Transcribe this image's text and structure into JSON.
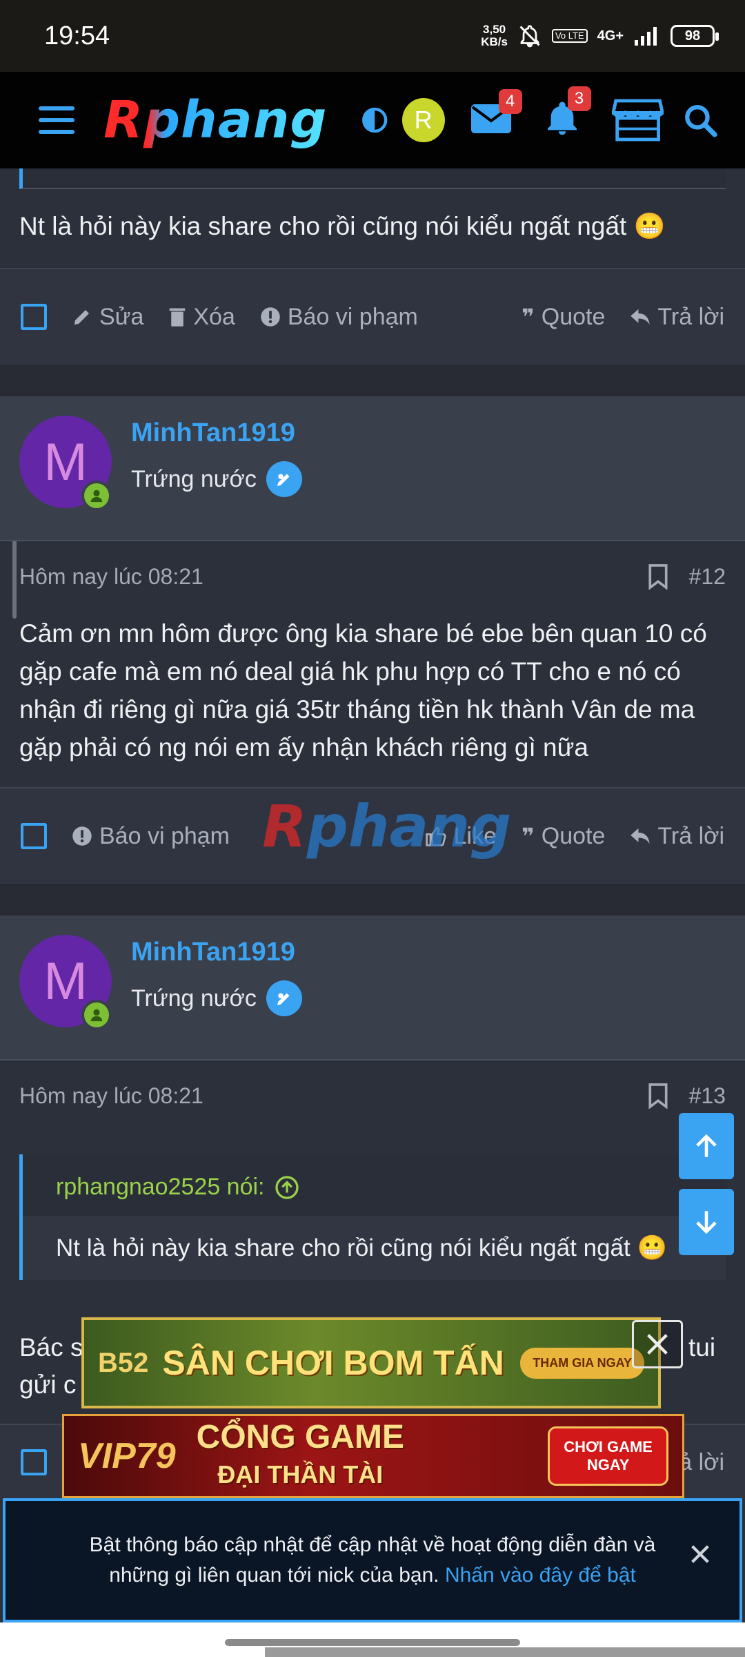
{
  "status_bar": {
    "time": "19:54",
    "net_speed_value": "3,50",
    "net_speed_unit": "KB/s",
    "volte": "Vo LTE",
    "network": "4G+",
    "battery": "98"
  },
  "app_bar": {
    "logo": "Rphang",
    "avatar_letter": "R",
    "messages_count": "4",
    "alerts_count": "3",
    "accent_color": "#3aa3f2"
  },
  "posts": [
    {
      "content": "Nt là hỏi này kia share cho rồi cũng nói kiểu ngất ngất 😬",
      "actions": {
        "edit": "Sửa",
        "delete": "Xóa",
        "report": "Báo vi phạm",
        "quote": "Quote",
        "reply": "Trả lời"
      }
    },
    {
      "user": {
        "initial": "M",
        "name": "MinhTan1919",
        "title": "Trứng nước"
      },
      "time": "Hôm nay lúc 08:21",
      "number": "#12",
      "content": "Cảm ơn mn hôm được ông kia share bé ebe bên quan 10 có gặp cafe mà em nó deal giá hk phu hợp có TT cho e nó có nhận đi riêng gì nữa giá 35tr tháng tiền hk thành Vân de ma gặp phải có ng nói em ấy nhận khách riêng gì nữa",
      "actions": {
        "report": "Báo vi phạm",
        "like": "Like",
        "quote": "Quote",
        "reply": "Trả lời"
      }
    },
    {
      "user": {
        "initial": "M",
        "name": "MinhTan1919",
        "title": "Trứng nước"
      },
      "time": "Hôm nay lúc 08:21",
      "number": "#13",
      "quote": {
        "author": "rphangnao2525 nói:",
        "text": "Nt là hỏi này kia share cho rồi cũng nói kiểu ngất ngất 😬"
      },
      "content_line1_start": "Bác s",
      "content_line1_end": "tui",
      "content_line2_start": "gửi c",
      "actions_reply_partial": "ả lời"
    }
  ],
  "watermark": {
    "r": "R",
    "rest": "phang"
  },
  "ads": {
    "banner1": {
      "logo": "B52",
      "text": "SÂN CHƠI BOM TẤN",
      "button": "THAM GIA NGAY"
    },
    "banner2": {
      "logo": "VIP79",
      "line1": "CỔNG GAME",
      "line2": "ĐẠI THẦN TÀI",
      "button_line1": "CHƠI GAME",
      "button_line2": "NGAY"
    }
  },
  "notice": {
    "text": "Bật thông báo cập nhật để cập nhật về hoạt động diễn đàn và những gì liên quan tới nick của bạn.",
    "link": "Nhấn vào đây để bật"
  }
}
